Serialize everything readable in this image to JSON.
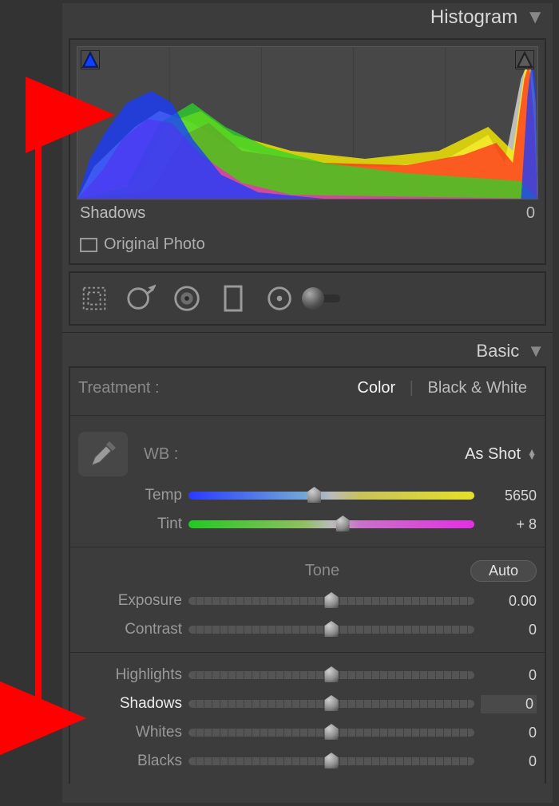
{
  "histogram_panel": {
    "title": "Histogram",
    "readout_label": "Shadows",
    "readout_value": "0",
    "original_photo_label": "Original Photo",
    "clip_left_icon": "clipping-left-triangle",
    "clip_right_icon": "clipping-right-triangle"
  },
  "tools": [
    "crop",
    "spot",
    "redeye",
    "grad",
    "radial",
    "brush"
  ],
  "basic_panel": {
    "title": "Basic",
    "treatment_label": "Treatment :",
    "treatment_options": [
      "Color",
      "Black & White"
    ],
    "treatment_selected": "Color",
    "wb_label": "WB :",
    "wb_value": "As Shot",
    "temp": {
      "label": "Temp",
      "value": "5650",
      "pos": 0.44
    },
    "tint": {
      "label": "Tint",
      "value": "+ 8",
      "pos": 0.54
    },
    "tone_label": "Tone",
    "auto_label": "Auto",
    "exposure": {
      "label": "Exposure",
      "value": "0.00",
      "pos": 0.5
    },
    "contrast": {
      "label": "Contrast",
      "value": "0",
      "pos": 0.5
    },
    "highlights": {
      "label": "Highlights",
      "value": "0",
      "pos": 0.5
    },
    "shadows": {
      "label": "Shadows",
      "value": "0",
      "pos": 0.5
    },
    "whites": {
      "label": "Whites",
      "value": "0",
      "pos": 0.5
    },
    "blacks": {
      "label": "Blacks",
      "value": "0",
      "pos": 0.5
    }
  },
  "colors": {
    "arrow": "#ff0000",
    "accent_blue": "#1040ff"
  }
}
